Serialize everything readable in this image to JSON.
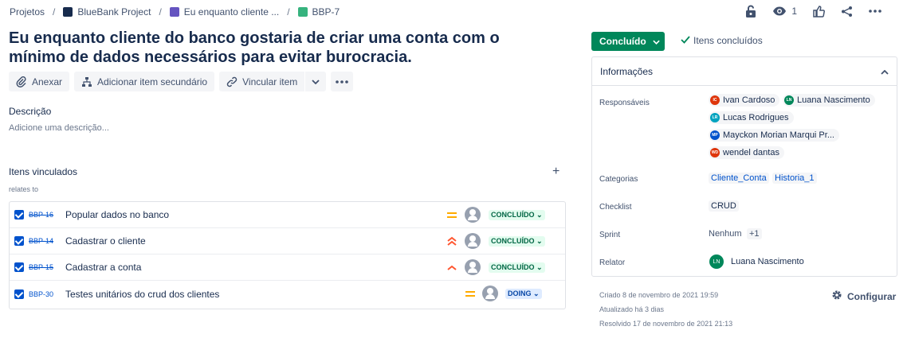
{
  "breadcrumb": {
    "projects": "Projetos",
    "project": "BlueBank Project",
    "parent": "Eu enquanto cliente ...",
    "issue": "BBP-7"
  },
  "header": {
    "watchers": "1"
  },
  "issue": {
    "title": "Eu enquanto cliente do banco gostaria de criar uma conta com o mínimo de dados necessários para evitar burocracia."
  },
  "toolbar": {
    "attach": "Anexar",
    "child": "Adicionar item secundário",
    "link": "Vincular item"
  },
  "description": {
    "label": "Descrição",
    "placeholder": "Adicione uma descrição..."
  },
  "linked": {
    "title": "Itens vinculados",
    "relation": "relates to",
    "items": [
      {
        "key": "BBP-16",
        "summary": "Popular dados no banco",
        "status": "CONCLUÍDO",
        "priority": "medium"
      },
      {
        "key": "BBP-14",
        "summary": "Cadastrar o cliente",
        "status": "CONCLUÍDO",
        "priority": "highest"
      },
      {
        "key": "BBP-15",
        "summary": "Cadastrar a conta",
        "status": "CONCLUÍDO",
        "priority": "high"
      },
      {
        "key": "BBP-30",
        "summary": "Testes unitários do crud dos clientes",
        "status": "DOING",
        "priority": "medium"
      }
    ]
  },
  "status": {
    "label": "Concluído",
    "resolution": "Itens concluídos"
  },
  "details": {
    "title": "Informações",
    "assignees_label": "Responsáveis",
    "assignees": [
      {
        "initials": "IC",
        "name": "Ivan Cardoso",
        "color": "#de350b"
      },
      {
        "initials": "LN",
        "name": "Luana Nascimento",
        "color": "#00875a"
      },
      {
        "initials": "LR",
        "name": "Lucas Rodrigues",
        "color": "#00a3bf"
      },
      {
        "initials": "MP",
        "name": "Mayckon Morian Marqui Pr...",
        "color": "#0052cc"
      },
      {
        "initials": "WD",
        "name": "wendel dantas",
        "color": "#de350b"
      }
    ],
    "categories_label": "Categorias",
    "categories": [
      "Cliente_Conta",
      "Historia_1"
    ],
    "checklist_label": "Checklist",
    "checklist": "CRUD",
    "sprint_label": "Sprint",
    "sprint": "Nenhum",
    "sprint_more": "+1",
    "reporter_label": "Relator",
    "reporter": {
      "initials": "LN",
      "name": "Luana Nascimento",
      "color": "#00875a"
    }
  },
  "meta": {
    "created": "Criado 8 de novembro de 2021 19:59",
    "updated": "Atualizado há 3 dias",
    "resolved": "Resolvido 17 de novembro de 2021 21:13",
    "configure": "Configurar"
  },
  "colors": {
    "accent": "#0052cc",
    "done": "#00875a",
    "medium": "#ffab00",
    "high": "#ff5630"
  }
}
